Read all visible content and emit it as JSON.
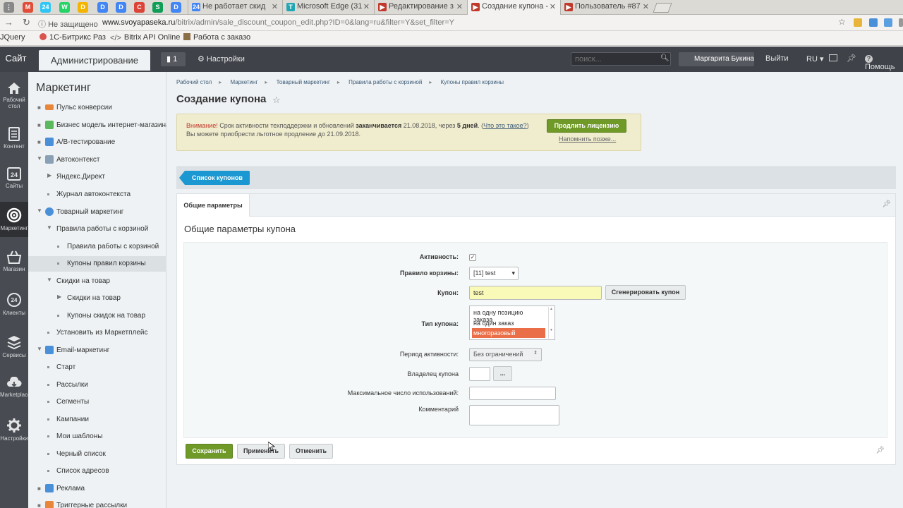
{
  "browser": {
    "pinned_tabs": [
      {
        "icon": "gmail-icon",
        "color": "#e04e39",
        "text": "M"
      },
      {
        "icon": "bitrix24-icon",
        "color": "#2fc6f6",
        "text": "24"
      },
      {
        "icon": "whatsapp-icon",
        "color": "#25d366",
        "text": "W"
      },
      {
        "icon": "drive-icon",
        "color": "#f4b400",
        "text": "D"
      },
      {
        "icon": "docs-icon",
        "color": "#4285f4",
        "text": "D"
      },
      {
        "icon": "docs-icon",
        "color": "#4285f4",
        "text": "D"
      },
      {
        "icon": "chrome-icon",
        "color": "#db4437",
        "text": "C"
      },
      {
        "icon": "sheets-icon",
        "color": "#0f9d58",
        "text": "S"
      }
    ],
    "tabs": [
      {
        "title": "Не работает скид",
        "icon_color": "#4285f4",
        "icon_text": "24"
      },
      {
        "title": "Microsoft Edge (31",
        "icon_color": "#22a6b3",
        "icon_text": "T"
      },
      {
        "title": "Редактирование з",
        "icon_color": "#c0392b",
        "icon_text": "▶"
      },
      {
        "title": "Создание купона -",
        "icon_color": "#c0392b",
        "icon_text": "▶"
      },
      {
        "title": "Пользователь #87",
        "icon_color": "#c0392b",
        "icon_text": "▶"
      }
    ],
    "insecure_label": "Не защищено",
    "url_host": "www.svoyapaseka.ru",
    "url_rest": "/bitrix/admin/sale_discount_coupon_edit.php?ID=0&lang=ru&filter=Y&set_filter=Y",
    "bookmarks": [
      "JQuery",
      "1С-Битрикс Раз",
      "Bitrix API Online",
      "Работа с заказо"
    ]
  },
  "top_panel": {
    "site": "Сайт",
    "admin": "Администрирование",
    "notifications": "1",
    "settings": "Настройки",
    "search_placeholder": "поиск...",
    "user": "Маргарита Букина",
    "logout": "Выйти",
    "lang": "RU",
    "help": "Помощь"
  },
  "icon_menu": [
    {
      "icon": "home-icon",
      "label": "Рабочий стол"
    },
    {
      "icon": "content-icon",
      "label": "Контент"
    },
    {
      "icon": "sites-icon",
      "label": "Сайты"
    },
    {
      "icon": "marketing-icon",
      "label": "Маркетинг"
    },
    {
      "icon": "shop-icon",
      "label": "Магазин"
    },
    {
      "icon": "clients-icon",
      "label": "Клиенты"
    },
    {
      "icon": "services-icon",
      "label": "Сервисы"
    },
    {
      "icon": "marketplace-icon",
      "label": "Marketplace"
    },
    {
      "icon": "settings-icon",
      "label": "Настройки"
    }
  ],
  "sidebar": {
    "title": "Маркетинг",
    "items": [
      {
        "label": "Пульс конверсии"
      },
      {
        "label": "Бизнес модель интернет-магазина"
      },
      {
        "label": "A/B-тестирование"
      },
      {
        "label": "Автоконтекст"
      },
      {
        "label": "Яндекс.Директ"
      },
      {
        "label": "Журнал автоконтекста"
      },
      {
        "label": "Товарный маркетинг"
      },
      {
        "label": "Правила работы с корзиной"
      },
      {
        "label": "Правила работы с корзиной"
      },
      {
        "label": "Купоны правил корзины"
      },
      {
        "label": "Скидки на товар"
      },
      {
        "label": "Скидки на товар"
      },
      {
        "label": "Купоны скидок на товар"
      },
      {
        "label": "Установить из Маркетплейс"
      },
      {
        "label": "Email-маркетинг"
      },
      {
        "label": "Старт"
      },
      {
        "label": "Рассылки"
      },
      {
        "label": "Сегменты"
      },
      {
        "label": "Кампании"
      },
      {
        "label": "Мои шаблоны"
      },
      {
        "label": "Черный список"
      },
      {
        "label": "Список адресов"
      },
      {
        "label": "Реклама"
      },
      {
        "label": "Триггерные рассылки"
      }
    ]
  },
  "breadcrumb": [
    "Рабочий стол",
    "Маркетинг",
    "Товарный маркетинг",
    "Правила работы с корзиной",
    "Купоны правил корзины"
  ],
  "page_title": "Создание купона",
  "warning": {
    "attention": "Внимание!",
    "text1": " Срок активности техподдержки и обновлений ",
    "ends": "заканчивается",
    "date": " 21.08.2018, через ",
    "days": "5 дней",
    "dot": ". (",
    "what": "Что это такое?",
    "close": ")",
    "text2": "Вы можете приобрести льготное продление до 21.09.2018.",
    "extend_button": "Продлить лицензию",
    "remind_later": "Напомнить позже..."
  },
  "coupon_list_button": "Список купонов",
  "tab_general": "Общие параметры",
  "form_title": "Общие параметры купона",
  "form": {
    "active_label": "Активность:",
    "active_checked": true,
    "rule_label": "Правило корзины:",
    "rule_value": "[11] test",
    "coupon_label": "Купон:",
    "coupon_value": "test",
    "generate_button": "Сгенерировать купон",
    "type_label": "Тип купона:",
    "type_options": [
      "на одну позицию заказа",
      "на один заказ",
      "многоразовый"
    ],
    "type_selected": 2,
    "period_label": "Период активности:",
    "period_value": "Без ограничений",
    "owner_label": "Владелец купона",
    "owner_button": "...",
    "max_uses_label": "Максимальное число использований:",
    "comment_label": "Комментарий"
  },
  "actions": {
    "save": "Сохранить",
    "apply": "Применить",
    "cancel": "Отменить"
  }
}
